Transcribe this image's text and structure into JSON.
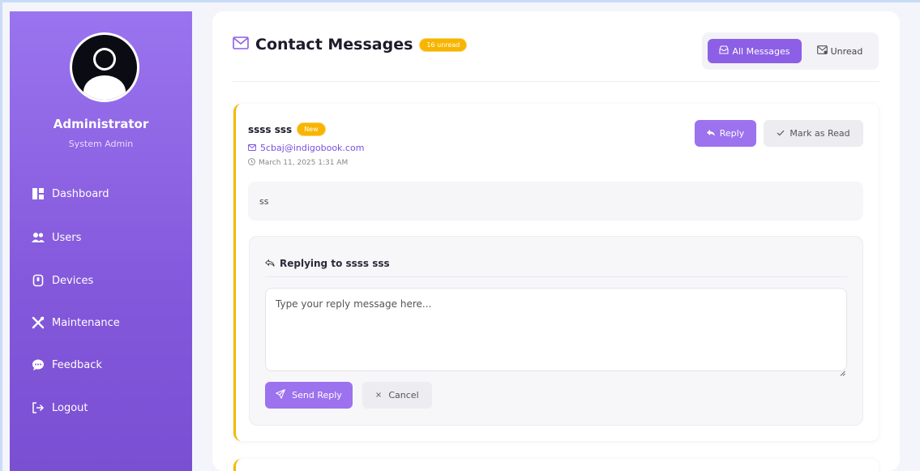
{
  "sidebar": {
    "admin_name": "Administrator",
    "admin_role": "System Admin",
    "items": [
      {
        "label": "Dashboard",
        "icon": "dashboard-icon"
      },
      {
        "label": "Users",
        "icon": "users-icon"
      },
      {
        "label": "Devices",
        "icon": "devices-icon"
      },
      {
        "label": "Maintenance",
        "icon": "maintenance-icon"
      },
      {
        "label": "Feedback",
        "icon": "feedback-icon"
      },
      {
        "label": "Logout",
        "icon": "logout-icon"
      }
    ]
  },
  "header": {
    "title": "Contact Messages",
    "unread_badge": "16 unread",
    "filters": {
      "all": "All Messages",
      "unread": "Unread"
    }
  },
  "message": {
    "sender": "ssss sss",
    "new_badge": "New",
    "email": "5cbaj@indigobook.com",
    "date": "March 11, 2025 1:31 AM",
    "body": "ss",
    "reply_button": "Reply",
    "mark_read_button": "Mark as Read"
  },
  "reply": {
    "title": "Replying to ssss sss",
    "placeholder": "Type your reply message here...",
    "send_button": "Send Reply",
    "cancel_button": "Cancel"
  },
  "colors": {
    "accent": "#8c5fe6",
    "badge": "#f7b500",
    "sidebar_top": "#9a74ef",
    "sidebar_bottom": "#7a4fd2"
  }
}
